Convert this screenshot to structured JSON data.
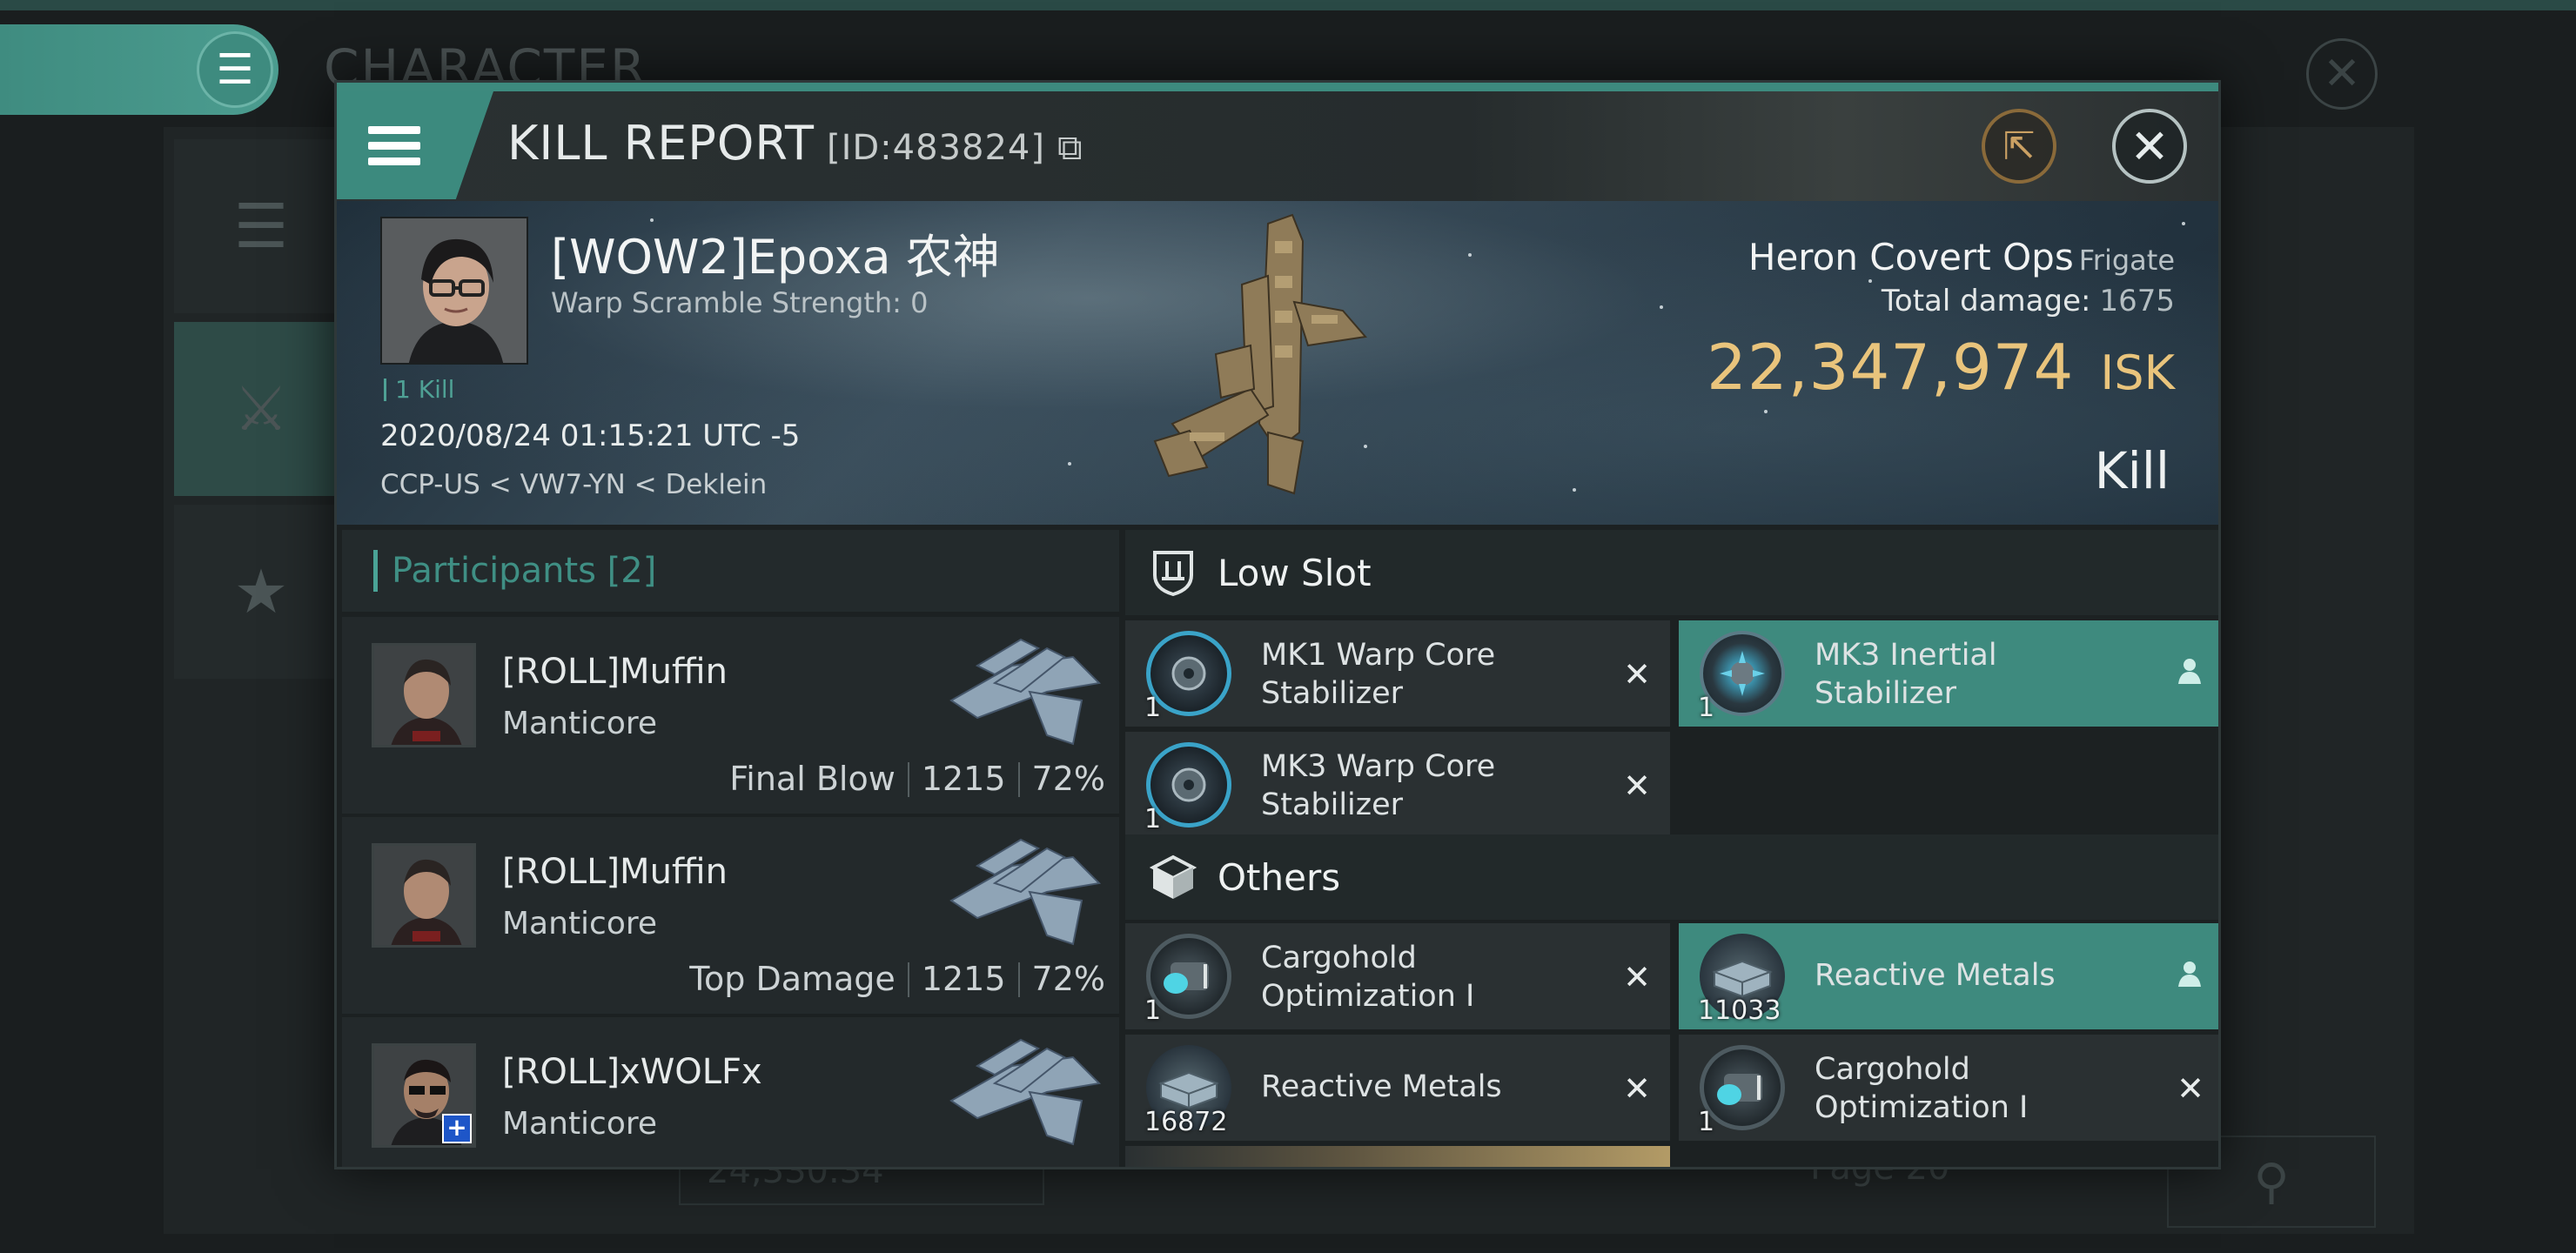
{
  "background": {
    "title": "CHARACTER",
    "isk_partial": "24,330.34",
    "page_label": "Page 20"
  },
  "modal": {
    "title": "KILL REPORT",
    "id": "[ID:483824]",
    "share_icon": "share-external-icon",
    "close_icon": "close-x-icon"
  },
  "victim": {
    "name": "[WOW2]Epoxa 农神",
    "warp_scramble": "Warp Scramble Strength: 0",
    "kill_count": "1 Kill",
    "timestamp": "2020/08/24 01:15:21 UTC -5",
    "location": "CCP-US < VW7-YN < Deklein",
    "ship_name": "Heron Covert Ops",
    "ship_class": "Frigate",
    "total_damage_label": "Total damage:",
    "total_damage": "1675",
    "isk_value": "22,347,974",
    "isk_unit": "ISK",
    "result": "Kill"
  },
  "participants": {
    "header": "Participants [2]",
    "rows": [
      {
        "name": "[ROLL]Muffin",
        "ship": "Manticore",
        "tag": "Final Blow",
        "damage": "1215",
        "percent": "72%"
      },
      {
        "name": "[ROLL]Muffin",
        "ship": "Manticore",
        "tag": "Top Damage",
        "damage": "1215",
        "percent": "72%"
      },
      {
        "name": "[ROLL]xWOLFx",
        "ship": "Manticore"
      }
    ]
  },
  "low_slot": {
    "title": "Low Slot",
    "items": [
      {
        "name": "MK1 Warp Core Stabilizer",
        "qty": "1",
        "status": "destroyed"
      },
      {
        "name": "MK3 Inertial Stabilizer",
        "qty": "1",
        "status": "dropped"
      },
      {
        "name": "MK3 Warp Core Stabilizer",
        "qty": "1",
        "status": "destroyed"
      }
    ]
  },
  "others": {
    "title": "Others",
    "items": [
      {
        "name": "Cargohold Optimization I",
        "qty": "1",
        "status": "destroyed"
      },
      {
        "name": "Reactive Metals",
        "qty": "11033",
        "status": "dropped"
      },
      {
        "name": "Reactive Metals",
        "qty": "16872",
        "status": "destroyed"
      },
      {
        "name": "Cargohold Optimization I",
        "qty": "1",
        "status": "destroyed"
      }
    ]
  },
  "colors": {
    "accent": "#3e8a7e",
    "isk": "#e9c47c"
  }
}
